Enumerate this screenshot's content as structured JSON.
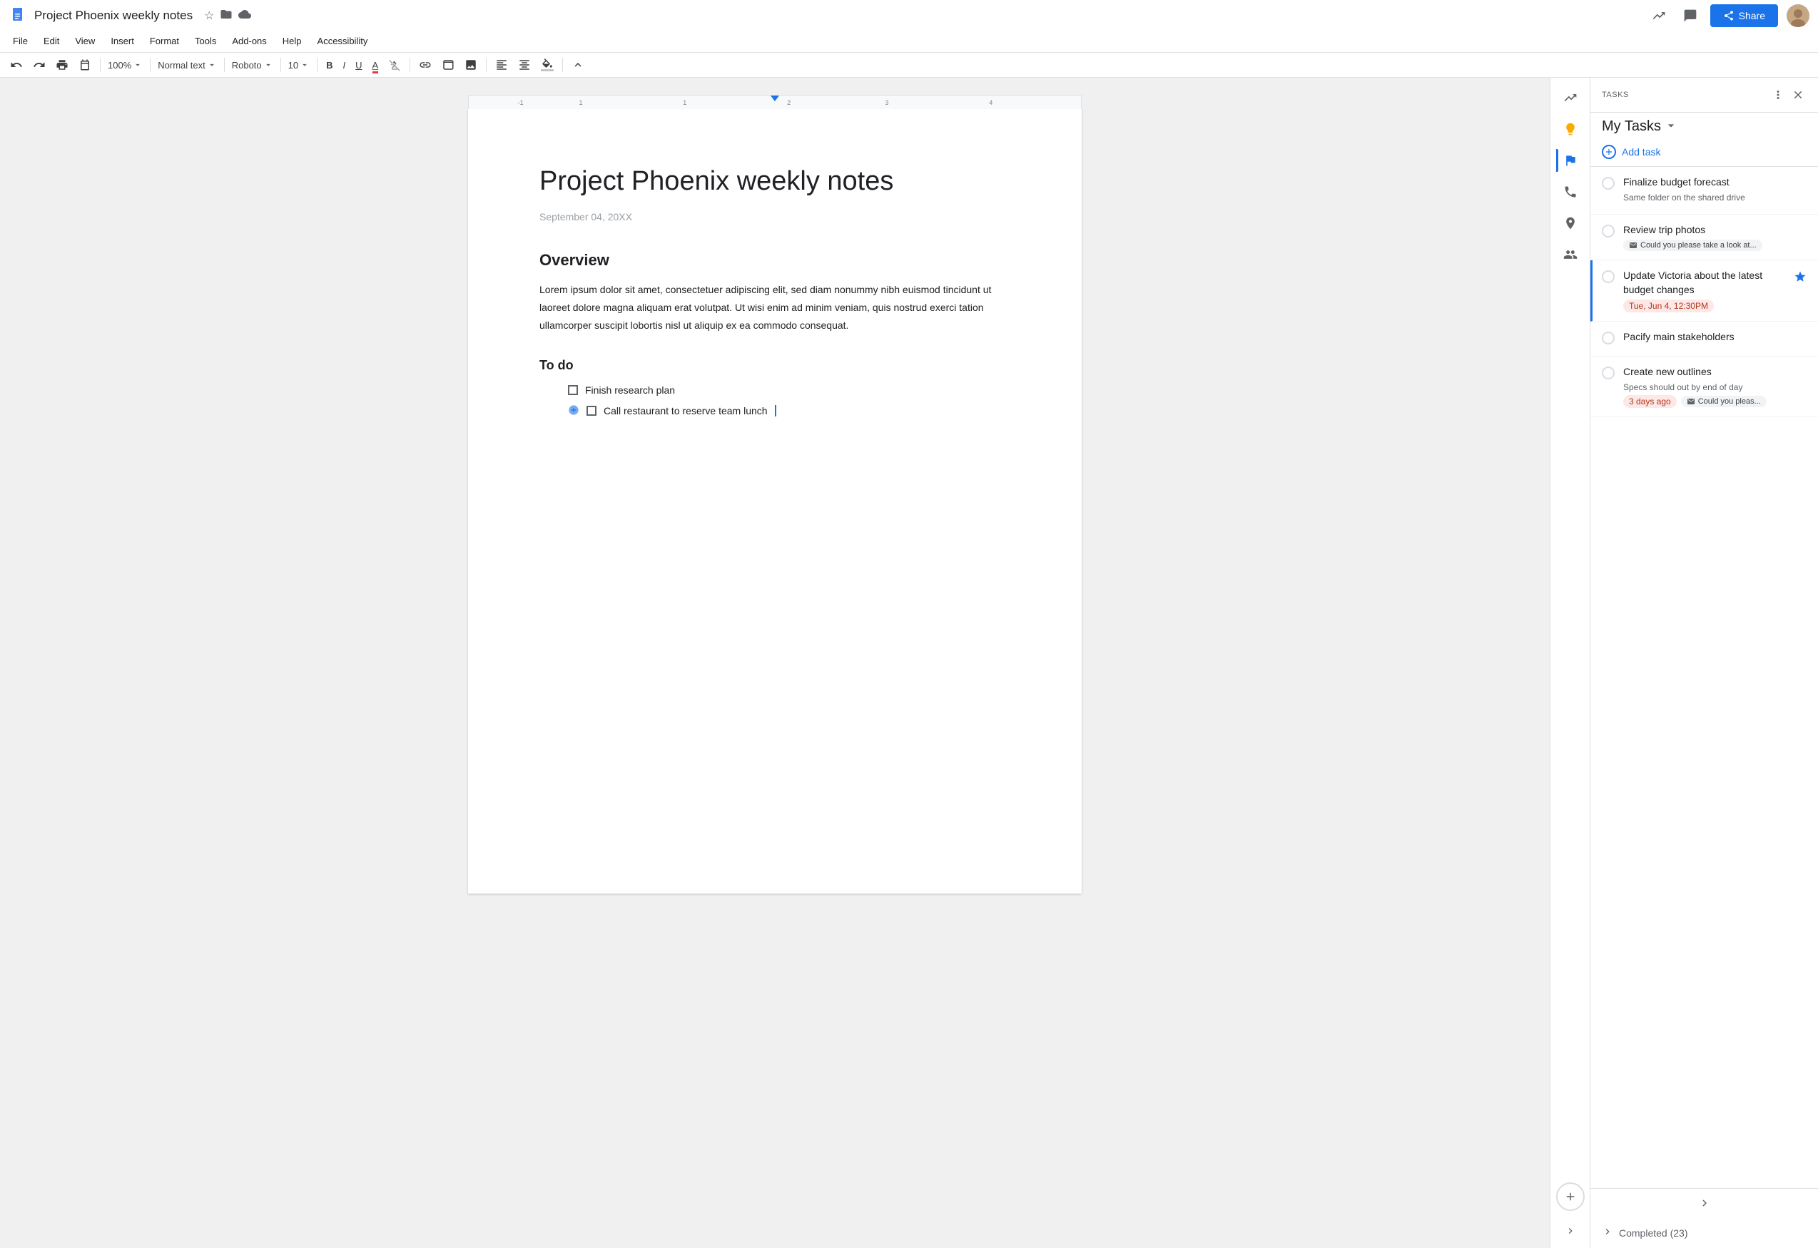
{
  "window": {
    "title": "Project Phoenix weekly notes"
  },
  "title_bar": {
    "doc_title": "Project Phoenix weekly notes",
    "star_icon": "★",
    "folder_icon": "📁",
    "cloud_icon": "☁"
  },
  "top_right": {
    "trending_icon": "📈",
    "comment_icon": "💬",
    "share_label": "Share"
  },
  "menu": {
    "items": [
      "File",
      "Edit",
      "View",
      "Insert",
      "Format",
      "Tools",
      "Add-ons",
      "Help",
      "Accessibility"
    ]
  },
  "toolbar": {
    "undo_label": "↩",
    "redo_label": "↪",
    "print_label": "🖨",
    "paint_label": "✏",
    "zoom_label": "100%",
    "style_label": "Normal text",
    "font_label": "Roboto",
    "size_label": "10",
    "bold_label": "B",
    "italic_label": "I",
    "underline_label": "U",
    "color_label": "A",
    "highlight_label": "🖊",
    "link_label": "🔗",
    "table_label": "⊞",
    "image_label": "🖼",
    "align_left_label": "≡",
    "align_center_label": "≡",
    "paint2_label": "🖌",
    "expand_label": "∧"
  },
  "document": {
    "title": "Project Phoenix weekly notes",
    "date": "September 04, 20XX",
    "section1": "Overview",
    "paragraph": "Lorem ipsum dolor sit amet, consectetuer adipiscing elit, sed diam nonummy nibh euismod tincidunt ut laoreet dolore magna aliquam erat volutpat. Ut wisi enim ad minim veniam, quis nostrud exerci tation ullamcorper suscipit lobortis nisl ut aliquip ex ea commodo consequat.",
    "section2": "To do",
    "todo_items": [
      {
        "label": "Finish research plan"
      },
      {
        "label": "Call restaurant to reserve team lunch"
      }
    ]
  },
  "tasks_panel": {
    "label": "TASKS",
    "title": "My Tasks",
    "add_task_label": "Add task",
    "tasks": [
      {
        "id": "task1",
        "title": "Finalize budget forecast",
        "sub": "Same folder on the shared drive",
        "chips": [],
        "starred": false
      },
      {
        "id": "task2",
        "title": "Review trip photos",
        "sub": "",
        "chips": [
          {
            "type": "email",
            "label": "Could you please take a look at..."
          }
        ],
        "starred": false
      },
      {
        "id": "task3",
        "title": "Update Victoria about the latest budget changes",
        "sub": "",
        "chips": [
          {
            "type": "date",
            "label": "Tue, Jun 4, 12:30PM"
          }
        ],
        "starred": true
      },
      {
        "id": "task4",
        "title": "Pacify main stakeholders",
        "sub": "",
        "chips": [],
        "starred": false
      },
      {
        "id": "task5",
        "title": "Create new outlines",
        "sub": "Specs should out by end of day",
        "chips": [
          {
            "type": "date",
            "label": "3 days ago"
          },
          {
            "type": "email",
            "label": "Could you pleas..."
          }
        ],
        "starred": false
      }
    ],
    "completed_label": "Completed (23)"
  },
  "side_icons": {
    "icons": [
      {
        "name": "trending-icon",
        "symbol": "📈"
      },
      {
        "name": "keep-icon",
        "symbol": "💛"
      },
      {
        "name": "tasks-icon",
        "symbol": "✓",
        "active": true
      },
      {
        "name": "contacts-icon",
        "symbol": "📞"
      },
      {
        "name": "maps-icon",
        "symbol": "📍"
      },
      {
        "name": "people-icon",
        "symbol": "👥"
      }
    ]
  }
}
